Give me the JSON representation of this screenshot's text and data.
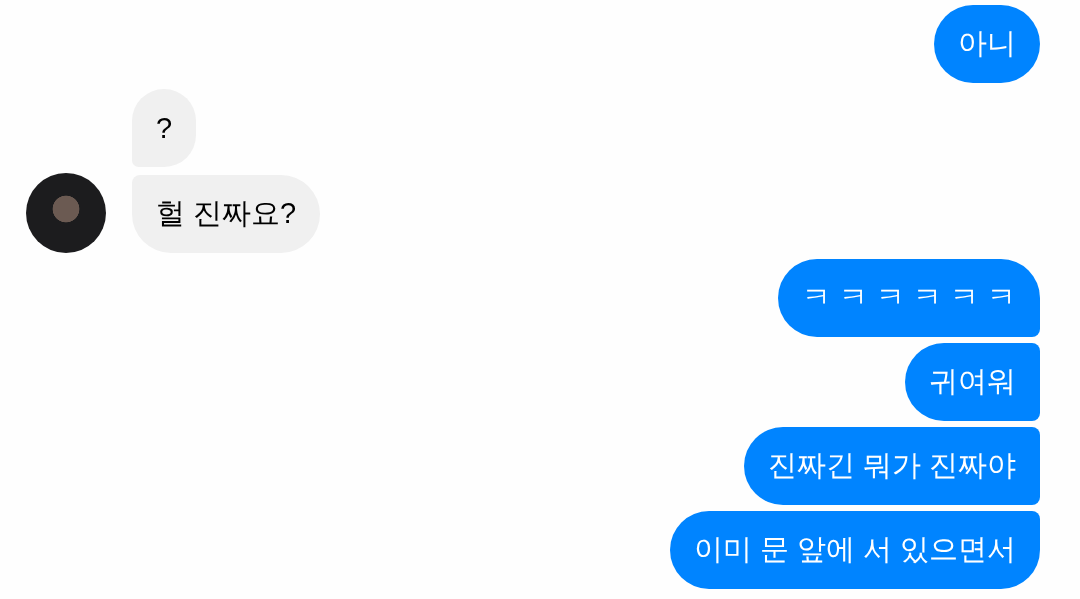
{
  "messages": [
    {
      "kind": "outgoing",
      "text": "아니"
    },
    {
      "kind": "incoming",
      "text": "?"
    },
    {
      "kind": "incoming",
      "text": "헐 진짜요?"
    },
    {
      "kind": "outgoing",
      "text": "ㅋ ㅋ ㅋ ㅋ ㅋ ㅋ"
    },
    {
      "kind": "outgoing",
      "text": "귀여워"
    },
    {
      "kind": "outgoing",
      "text": "진짜긴 뭐가 진짜야"
    },
    {
      "kind": "outgoing",
      "text": "이미 문 앞에 서 있으면서"
    }
  ]
}
